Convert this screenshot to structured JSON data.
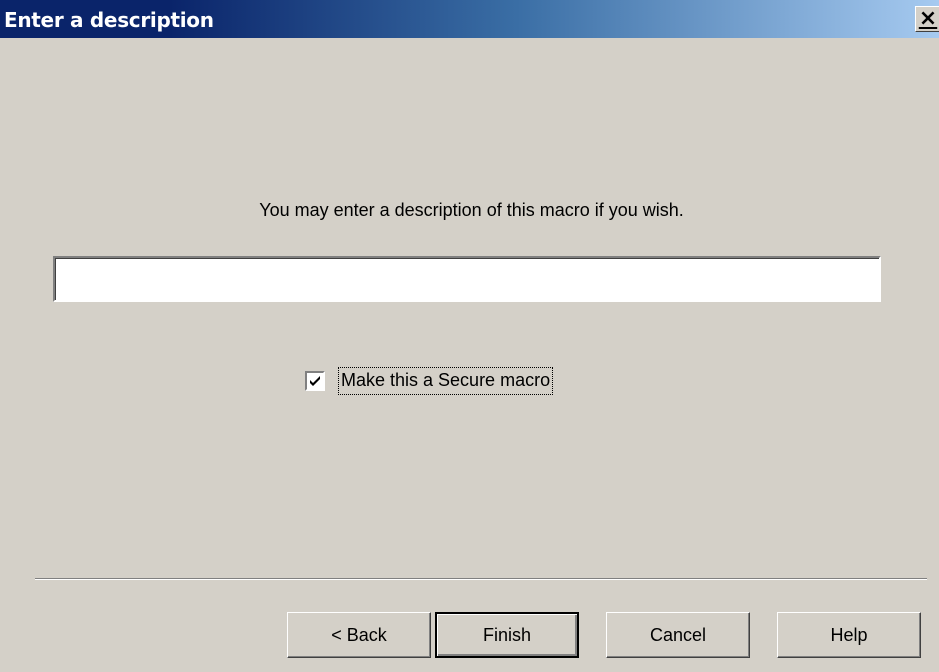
{
  "window": {
    "title": "Enter a description",
    "close_glyph": "✕"
  },
  "main": {
    "prompt": "You may enter a description of this macro if you wish.",
    "description_value": "",
    "checkbox": {
      "label": "Make this a Secure macro",
      "checked": true
    }
  },
  "buttons": {
    "back": "< Back",
    "finish": "Finish",
    "cancel": "Cancel",
    "help": "Help"
  },
  "icons": {
    "close": "close-icon",
    "check": "checkmark-icon"
  }
}
